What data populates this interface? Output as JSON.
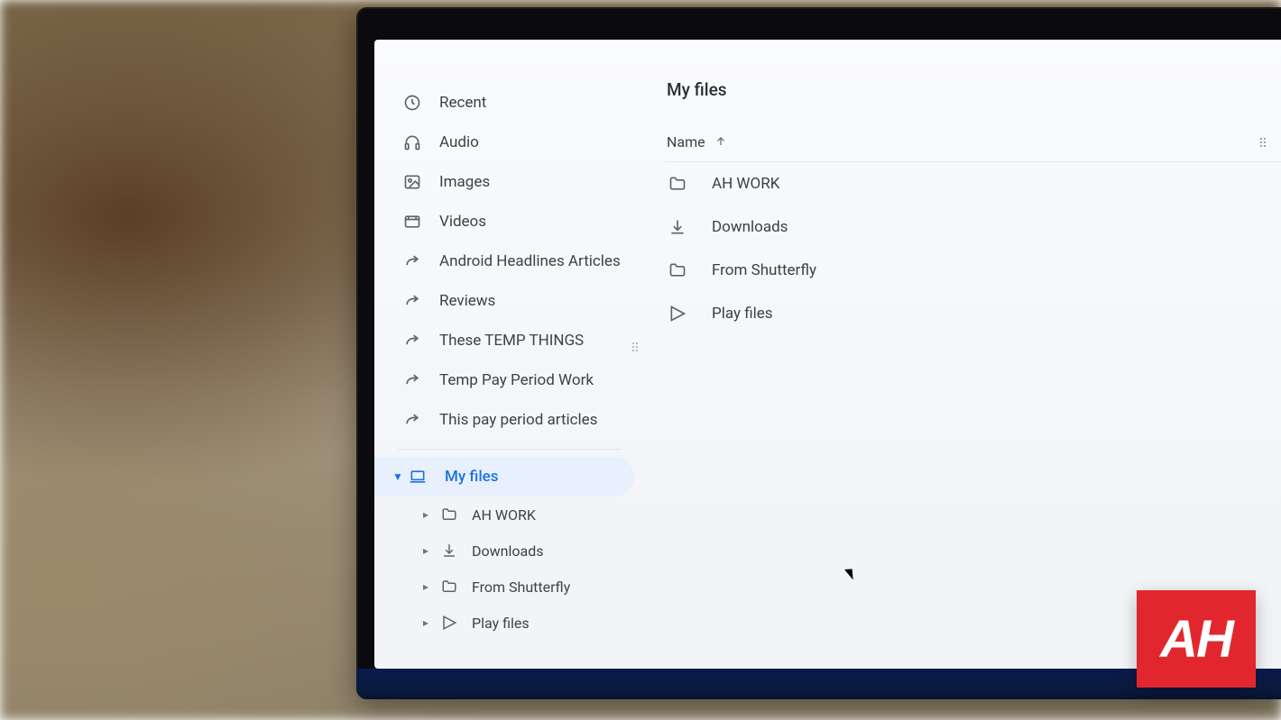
{
  "sidebar": {
    "quick": [
      {
        "icon": "clock-icon",
        "label": "Recent"
      },
      {
        "icon": "headphones-icon",
        "label": "Audio"
      },
      {
        "icon": "image-icon",
        "label": "Images"
      },
      {
        "icon": "video-icon",
        "label": "Videos"
      }
    ],
    "shortcuts": [
      {
        "icon": "shortcut-icon",
        "label": "Android Headlines Articles"
      },
      {
        "icon": "shortcut-icon",
        "label": "Reviews"
      },
      {
        "icon": "shortcut-icon",
        "label": "These TEMP THINGS"
      },
      {
        "icon": "shortcut-icon",
        "label": "Temp Pay Period Work"
      },
      {
        "icon": "shortcut-icon",
        "label": "This pay period articles"
      }
    ],
    "myfiles_label": "My files",
    "tree": [
      {
        "icon": "folder-icon",
        "label": "AH WORK"
      },
      {
        "icon": "download-icon",
        "label": "Downloads"
      },
      {
        "icon": "folder-icon",
        "label": "From Shutterfly"
      },
      {
        "icon": "play-icon",
        "label": "Play files"
      }
    ]
  },
  "main": {
    "title": "My files",
    "sort_column": "Name",
    "rows": [
      {
        "icon": "folder-icon",
        "label": "AH WORK"
      },
      {
        "icon": "download-icon",
        "label": "Downloads"
      },
      {
        "icon": "folder-icon",
        "label": "From Shutterfly"
      },
      {
        "icon": "play-icon",
        "label": "Play files"
      }
    ]
  },
  "badge": "AH"
}
